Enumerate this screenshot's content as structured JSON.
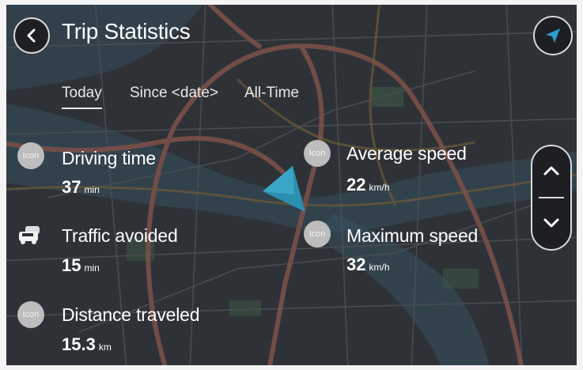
{
  "header": {
    "title": "Trip Statistics"
  },
  "tabs": [
    {
      "label": "Today",
      "active": true
    },
    {
      "label": "Since <date>",
      "active": false
    },
    {
      "label": "All-Time",
      "active": false
    }
  ],
  "stats": {
    "driving_time": {
      "icon_text": "Icon",
      "label": "Driving time",
      "value": "37",
      "unit": "min"
    },
    "traffic_avoided": {
      "icon": "car-traffic-icon",
      "label": "Traffic avoided",
      "value": "15",
      "unit": "min"
    },
    "distance_traveled": {
      "icon_text": "Icon",
      "label": "Distance traveled",
      "value": "15.3",
      "unit": "km"
    },
    "average_speed": {
      "icon_text": "Icon",
      "label": "Average speed",
      "value": "22",
      "unit": "km/h"
    },
    "maximum_speed": {
      "icon_text": "Icon",
      "label": "Maximum speed",
      "value": "32",
      "unit": "km/h"
    }
  },
  "colors": {
    "map_background": "#2e3236",
    "road": "#8a5a52",
    "water": "#3e6378",
    "accent_arrow": "#2b8fb0",
    "button_bg": "#1d1f22"
  },
  "icons": [
    "back-arrow-icon",
    "navigation-arrow-icon",
    "chevron-up-icon",
    "chevron-down-icon",
    "car-traffic-icon",
    "position-arrow-icon"
  ]
}
